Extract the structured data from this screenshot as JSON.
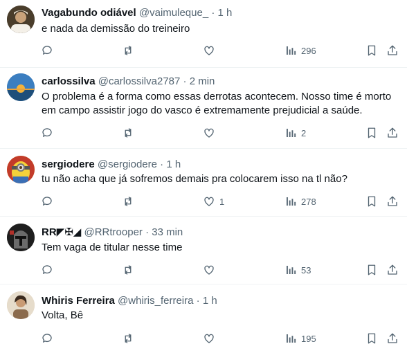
{
  "tweets": [
    {
      "name": "Vagabundo odiável",
      "handle": "@vaimuleque_",
      "dot": "·",
      "time": "1 h",
      "text": "e nada da demissão do treineiro",
      "reply_count": "",
      "retweet_count": "",
      "like_count": "",
      "views": "296",
      "avatar_color": "#3b3326"
    },
    {
      "name": "carlossilva",
      "handle": "@carlossilva2787",
      "dot": "·",
      "time": "2 min",
      "text": "O problema é a forma como essas derrotas acontecem. Nosso time é morto em campo assistir jogo do vasco é extremamente prejudicial a saúde.",
      "reply_count": "",
      "retweet_count": "",
      "like_count": "",
      "views": "2",
      "avatar_color": "#2c6fa8"
    },
    {
      "name": "sergiodere",
      "handle": "@sergiodere",
      "dot": "·",
      "time": "1 h",
      "text": "tu não acha que já sofremos demais pra colocarem isso na tl não?",
      "reply_count": "",
      "retweet_count": "",
      "like_count": "1",
      "views": "278",
      "avatar_color": "#f2c230"
    },
    {
      "name": "RR◤✠◢",
      "handle": "@RRtrooper",
      "dot": "·",
      "time": "33 min",
      "text": "Tem vaga de titular nesse time",
      "reply_count": "",
      "retweet_count": "",
      "like_count": "",
      "views": "53",
      "avatar_color": "#2a2a2a"
    },
    {
      "name": "Whiris Ferreira",
      "handle": "@whiris_ferreira",
      "dot": "·",
      "time": "1 h",
      "text": "Volta, Bê",
      "reply_count": "",
      "retweet_count": "",
      "like_count": "",
      "views": "195",
      "avatar_color": "#d9c7b0"
    }
  ]
}
